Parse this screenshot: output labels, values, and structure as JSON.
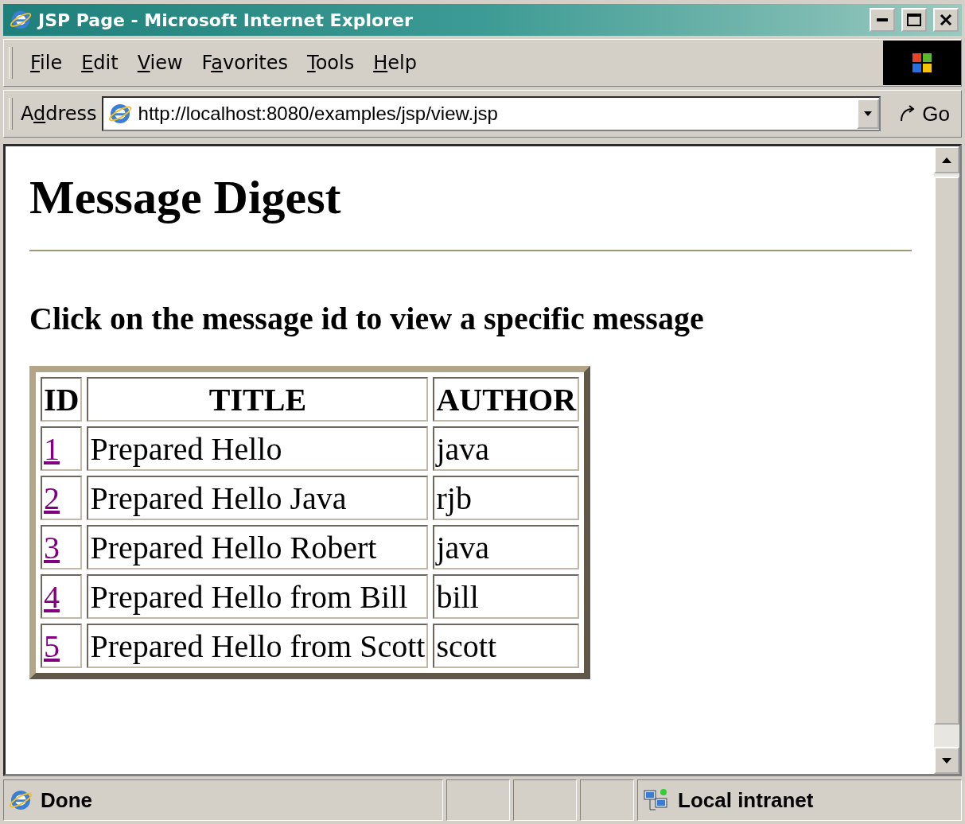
{
  "window": {
    "title": "JSP Page - Microsoft Internet Explorer"
  },
  "menu": [
    {
      "key": "F",
      "post": "ile"
    },
    {
      "key": "E",
      "post": "dit"
    },
    {
      "key": "V",
      "post": "iew"
    },
    {
      "pre": "F",
      "key": "a",
      "post": "vorites"
    },
    {
      "key": "T",
      "post": "ools"
    },
    {
      "key": "H",
      "post": "elp"
    }
  ],
  "address_bar": {
    "label": {
      "pre": "A",
      "key": "d",
      "post": "dress"
    },
    "value": "http://localhost:8080/examples/jsp/view.jsp",
    "go": "Go"
  },
  "page": {
    "heading": "Message Digest",
    "instruction": "Click on the message id to view a specific message",
    "table": {
      "columns": [
        "ID",
        "TITLE",
        "AUTHOR"
      ],
      "rows": [
        {
          "id": "1",
          "visited": true,
          "title": "Prepared Hello",
          "author": "java"
        },
        {
          "id": "2",
          "visited": true,
          "title": "Prepared Hello Java",
          "author": "rjb"
        },
        {
          "id": "3",
          "visited": true,
          "title": "Prepared Hello Robert",
          "author": "java"
        },
        {
          "id": "4",
          "visited": true,
          "title": "Prepared Hello from Bill",
          "author": "bill"
        },
        {
          "id": "5",
          "visited": true,
          "title": "Prepared Hello from Scott",
          "author": "scott"
        }
      ]
    }
  },
  "status_bar": {
    "status": "Done",
    "zone": "Local intranet"
  }
}
